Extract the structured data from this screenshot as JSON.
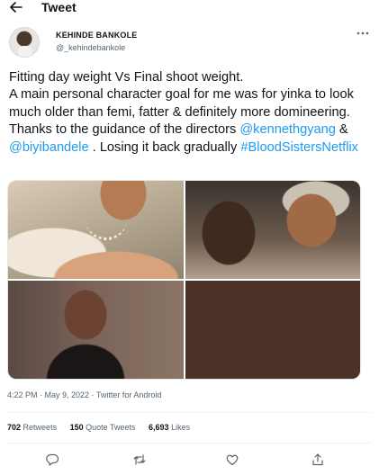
{
  "header": {
    "title": "Tweet"
  },
  "author": {
    "display_name": "KEHINDE BANKOLE",
    "handle": "@_kehindebankole"
  },
  "tweet": {
    "line1": "Fitting day weight Vs Final shoot weight.",
    "line2": "A main personal character goal for me was for yinka to look much older than femi, fatter & definitely more domineering. Thanks to the guidance of the directors ",
    "mention1": "@kennethgyang",
    "amp": " & ",
    "mention2": "@biyibandele",
    "tail": " . Losing it back gradually ",
    "hashtag": "#BloodSistersNetflix"
  },
  "meta": {
    "timestamp": "4:22 PM · May 9, 2022 · Twitter for Android"
  },
  "stats": {
    "retweets_count": "702",
    "retweets_label": "Retweets",
    "quotes_count": "150",
    "quotes_label": "Quote Tweets",
    "likes_count": "6,693",
    "likes_label": "Likes"
  },
  "icons": [
    "back-arrow-icon",
    "more-icon",
    "reply-icon",
    "retweet-icon",
    "like-icon",
    "share-icon"
  ],
  "colors": {
    "link": "#1d9bf0",
    "text": "#0f1419",
    "secondary": "#536471"
  }
}
